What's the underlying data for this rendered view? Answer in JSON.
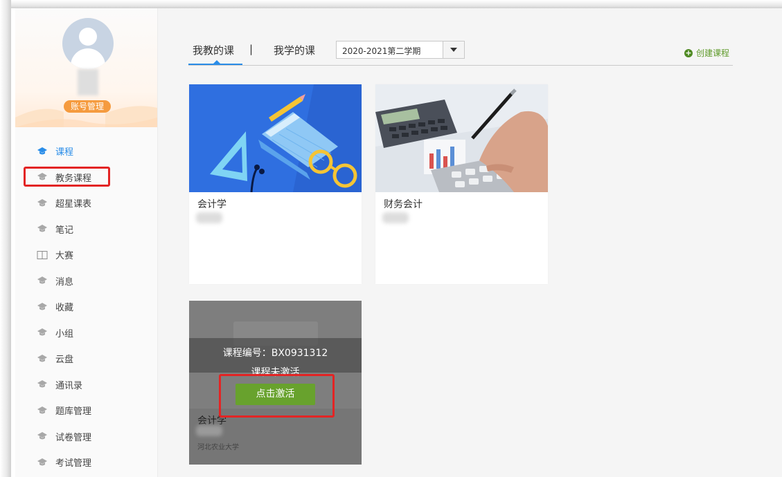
{
  "sidebar": {
    "account_button": "账号管理",
    "items": [
      {
        "label": "课程",
        "icon": "graduation-cap-icon",
        "active": true
      },
      {
        "label": "教务课程",
        "icon": "graduation-cap-icon"
      },
      {
        "label": "超星课表",
        "icon": "graduation-cap-icon"
      },
      {
        "label": "笔记",
        "icon": "graduation-cap-icon"
      },
      {
        "label": "大赛",
        "icon": "book-open-icon"
      },
      {
        "label": "消息",
        "icon": "graduation-cap-icon"
      },
      {
        "label": "收藏",
        "icon": "graduation-cap-icon"
      },
      {
        "label": "小组",
        "icon": "graduation-cap-icon"
      },
      {
        "label": "云盘",
        "icon": "graduation-cap-icon"
      },
      {
        "label": "通讯录",
        "icon": "graduation-cap-icon"
      },
      {
        "label": "题库管理",
        "icon": "graduation-cap-icon"
      },
      {
        "label": "试卷管理",
        "icon": "graduation-cap-icon"
      },
      {
        "label": "考试管理",
        "icon": "graduation-cap-icon"
      }
    ]
  },
  "header": {
    "tab_teach": "我教的课",
    "separator": "|",
    "tab_learn": "我学的课",
    "term_value": "2020-2021第二学期",
    "create_course": "创建课程"
  },
  "courses": [
    {
      "name": "会计学",
      "image": "accounting-stationery-illustration"
    },
    {
      "name": "财务会计",
      "image": "calculator-and-pen-photo"
    }
  ],
  "inactive_course": {
    "code_text": "课程编号：BX0931312",
    "status_text": "课程未激活",
    "activate_button": "点击激活",
    "name": "会计学",
    "school": "河北农业大学"
  },
  "colors": {
    "accent_blue": "#2a8de8",
    "account_orange": "#f59b3f",
    "activate_green": "#68a22d",
    "highlight_red": "#e32424"
  }
}
